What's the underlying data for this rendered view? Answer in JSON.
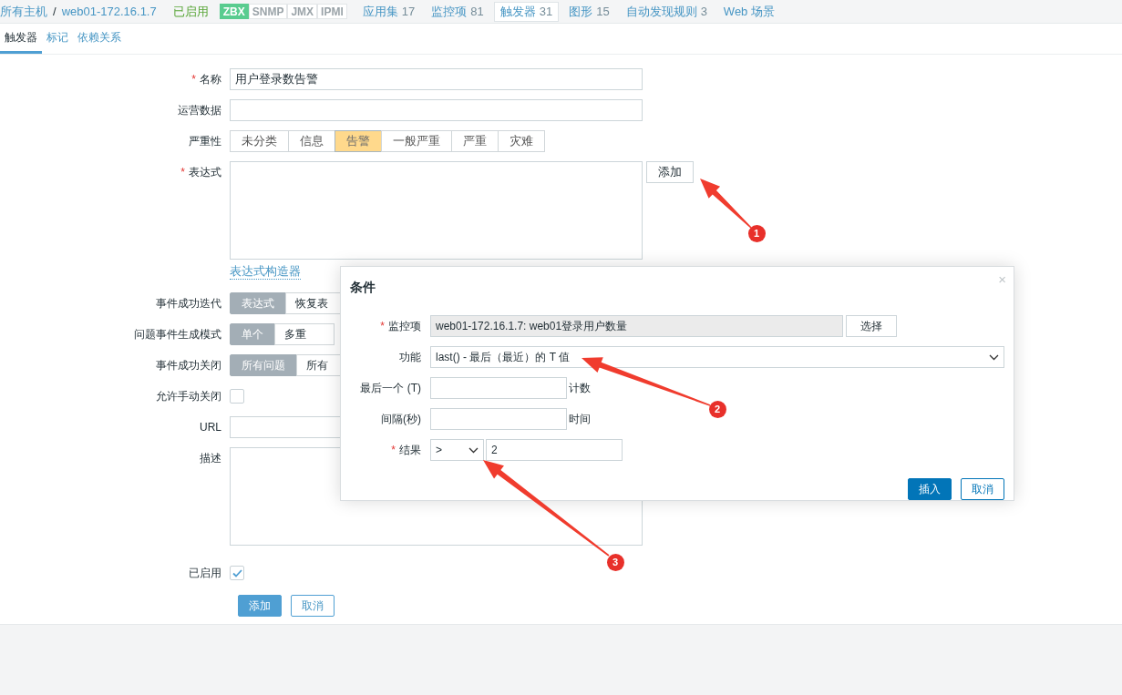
{
  "header": {
    "breadcrumb": [
      "所有主机",
      "web01-172.16.1.7"
    ],
    "separator": "/",
    "status": "已启用",
    "availability": [
      {
        "label": "ZBX",
        "on": true
      },
      {
        "label": "SNMP",
        "on": false
      },
      {
        "label": "JMX",
        "on": false
      },
      {
        "label": "IPMI",
        "on": false
      }
    ],
    "tabs": [
      {
        "label": "应用集",
        "count": "17",
        "selected": false
      },
      {
        "label": "监控项",
        "count": "81",
        "selected": false
      },
      {
        "label": "触发器",
        "count": "31",
        "selected": true
      },
      {
        "label": "图形",
        "count": "15",
        "selected": false
      },
      {
        "label": "自动发现规则",
        "count": "3",
        "selected": false
      },
      {
        "label": "Web 场景",
        "selected": false
      }
    ]
  },
  "subtabs": [
    {
      "label": "触发器",
      "selected": true
    },
    {
      "label": "标记",
      "selected": false
    },
    {
      "label": "依赖关系",
      "selected": false
    }
  ],
  "form": {
    "rows": [
      {
        "kind": "text",
        "label": "名称",
        "required": true,
        "value": "用户登录数告警"
      },
      {
        "kind": "text",
        "label": "运营数据",
        "required": false
      },
      {
        "kind": "severity",
        "label": "严重性",
        "options": [
          {
            "label": "未分类",
            "selected": false
          },
          {
            "label": "信息",
            "selected": false
          },
          {
            "label": "告警",
            "selected": true
          },
          {
            "label": "一般严重",
            "selected": false
          },
          {
            "label": "严重",
            "selected": false
          },
          {
            "label": "灾难",
            "selected": false
          }
        ]
      },
      {
        "kind": "expression",
        "label": "表达式",
        "required": true,
        "button": "添加",
        "link": "表达式构造器"
      },
      {
        "kind": "segmented",
        "label": "事件成功迭代",
        "options": [
          {
            "label": "表达式",
            "selected": true
          },
          {
            "label": "恢复表",
            "selected": false
          }
        ]
      },
      {
        "kind": "segmented",
        "label": "问题事件生成模式",
        "options": [
          {
            "label": "单个",
            "selected": true
          },
          {
            "label": "多重",
            "selected": false
          }
        ]
      },
      {
        "kind": "segmented",
        "label": "事件成功关闭",
        "options": [
          {
            "label": "所有问题",
            "selected": true
          },
          {
            "label": "所有",
            "selected": false
          }
        ]
      },
      {
        "kind": "checkbox",
        "label": "允许手动关闭",
        "checked": false
      },
      {
        "kind": "text",
        "label": "URL",
        "required": false
      },
      {
        "kind": "textarea",
        "label": "描述"
      },
      {
        "kind": "checkbox",
        "label": "已启用",
        "checked": true
      }
    ],
    "buttons": [
      {
        "label": "添加",
        "kind": "primary"
      },
      {
        "label": "取消",
        "kind": "secondary"
      }
    ]
  },
  "dialog": {
    "title": "条件",
    "close": "×",
    "rows": [
      {
        "kind": "item",
        "label": "监控项",
        "required": true,
        "value": "web01-172.16.1.7: web01登录用户数量",
        "button": "选择"
      },
      {
        "kind": "select",
        "label": "功能",
        "value": "last() - 最后（最近）的 T 值"
      },
      {
        "kind": "unit",
        "label": "最后一个 (T)",
        "unit": "计数"
      },
      {
        "kind": "unit",
        "label": "间隔(秒)",
        "unit": "时间"
      },
      {
        "kind": "result",
        "label": "结果",
        "required": true,
        "operator": ">",
        "value": "2"
      }
    ],
    "buttons": [
      {
        "label": "插入",
        "kind": "primary"
      },
      {
        "label": "取消",
        "kind": "secondary"
      }
    ]
  },
  "required_mark": "*",
  "annotations": [
    {
      "number": "1"
    },
    {
      "number": "2"
    },
    {
      "number": "3"
    }
  ]
}
